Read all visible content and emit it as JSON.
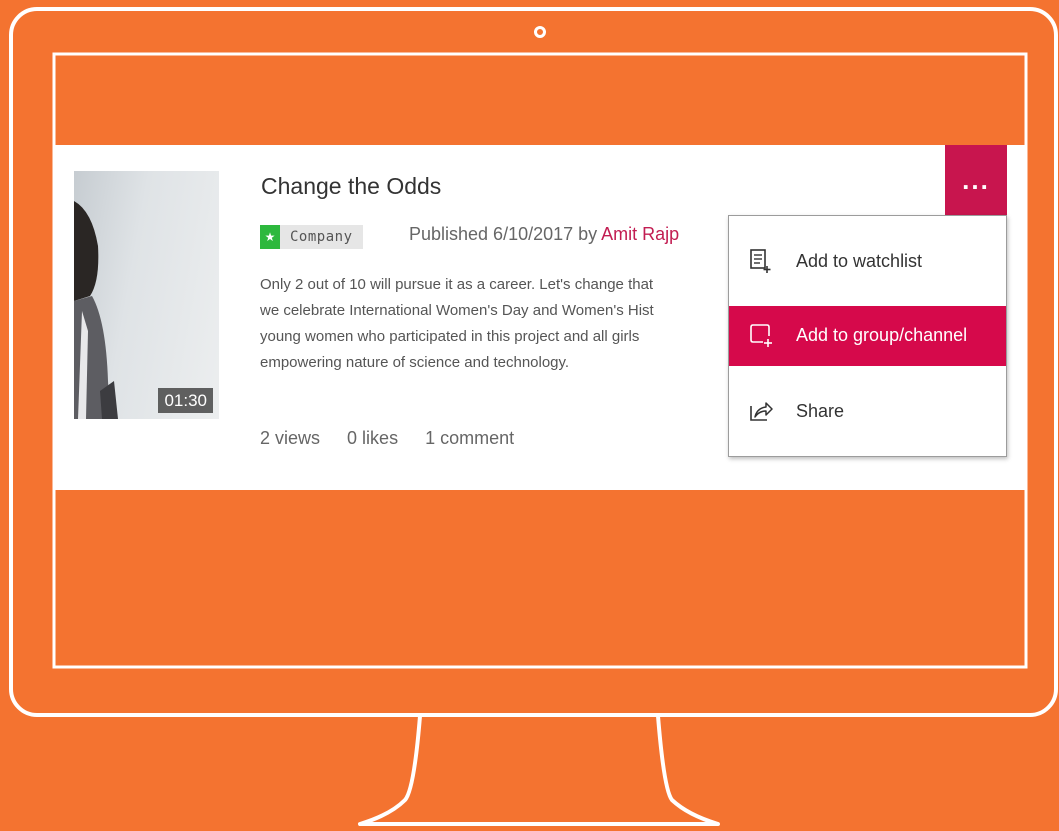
{
  "video": {
    "title": "Change the Odds",
    "duration": "01:30",
    "category": "Company",
    "published_prefix": "Published 6/10/2017 by",
    "author": "Amit Rajp",
    "description_lines": [
      "Only 2 out of 10 will pursue it as a career. Let's change that",
      "we celebrate International Women's Day and Women's Hist",
      "young women who participated in this project and all girls",
      "empowering nature of science and technology."
    ],
    "stats": {
      "views": "2 views",
      "likes": "0 likes",
      "comments": "1 comment"
    }
  },
  "more_button": {
    "label": "..."
  },
  "context_menu": {
    "items": [
      {
        "label": "Add to watchlist",
        "icon": "watchlist-icon",
        "highlighted": false
      },
      {
        "label": "Add to group/channel",
        "icon": "add-to-group-icon",
        "highlighted": true
      },
      {
        "label": "Share",
        "icon": "share-icon",
        "highlighted": false
      }
    ]
  },
  "colors": {
    "background": "#F47330",
    "accent": "#C8154E",
    "menu_highlight": "#D6094B",
    "category_icon": "#2DB83D"
  }
}
